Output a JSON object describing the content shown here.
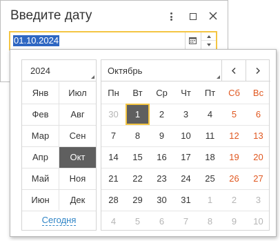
{
  "dialog": {
    "title": "Введите дату",
    "buttons": {
      "more": "more-vertical-icon",
      "maximize": "maximize-icon",
      "close": "close-icon"
    }
  },
  "date_field": {
    "value": "01.10.2024",
    "selection_color": "#2f67c2",
    "focus_border_color": "#f4c542"
  },
  "calendar": {
    "year": "2024",
    "month_selector": "Октябрь",
    "months": [
      "Янв",
      "Фев",
      "Мар",
      "Апр",
      "Май",
      "Июн",
      "Июл",
      "Авг",
      "Сен",
      "Окт",
      "Ноя",
      "Дек"
    ],
    "active_month_index": 9,
    "today_link": "Сегодня",
    "weekdays": [
      "Пн",
      "Вт",
      "Ср",
      "Чт",
      "Пт",
      "Сб",
      "Вс"
    ],
    "weeks": [
      [
        "30",
        "1",
        "2",
        "3",
        "4",
        "5",
        "6"
      ],
      [
        "7",
        "8",
        "9",
        "10",
        "11",
        "12",
        "13"
      ],
      [
        "14",
        "15",
        "16",
        "17",
        "18",
        "19",
        "20"
      ],
      [
        "21",
        "22",
        "23",
        "24",
        "25",
        "26",
        "27"
      ],
      [
        "28",
        "29",
        "30",
        "31",
        "1",
        "2",
        "3"
      ],
      [
        "4",
        "5",
        "6",
        "7",
        "8",
        "9",
        "10"
      ]
    ],
    "selected_day": "1",
    "colors": {
      "weekend": "#e0571f",
      "other_month": "#b5b5b5",
      "selected_bg": "#5f5f5f",
      "link": "#2e84c6"
    }
  }
}
